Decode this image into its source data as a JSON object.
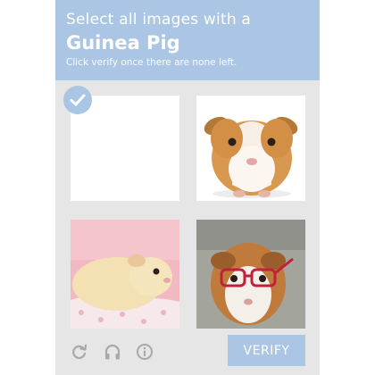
{
  "header": {
    "instruction": "Select all images with a",
    "target": "Guinea Pig",
    "hint": "Click verify once there are none left."
  },
  "tiles": [
    {
      "content": "empty",
      "selected": true
    },
    {
      "content": "guinea-pig"
    },
    {
      "content": "guinea-pig"
    },
    {
      "content": "guinea-pig"
    }
  ],
  "footer": {
    "icons": [
      "reload-icon",
      "headphones-icon",
      "info-icon"
    ],
    "verify_label": "VERIFY"
  },
  "colors": {
    "accent": "#aac6e4",
    "panel": "#e6e6e6",
    "icon": "#a9a9a9"
  }
}
